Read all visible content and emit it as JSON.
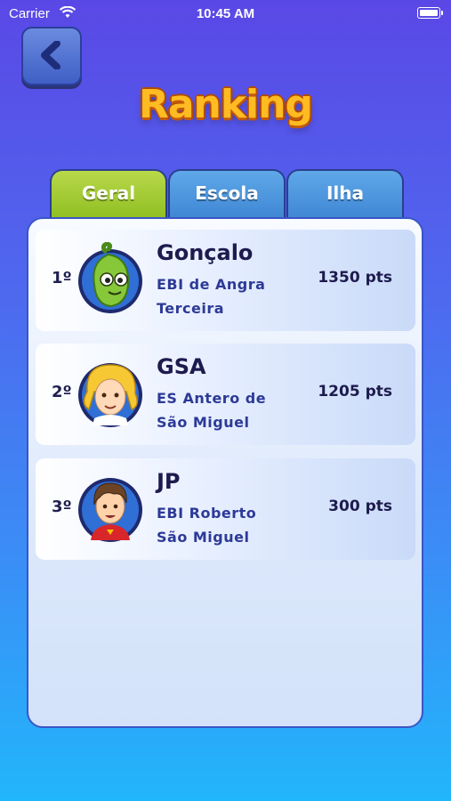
{
  "status_bar": {
    "carrier": "Carrier",
    "time": "10:45 AM"
  },
  "header": {
    "title": "Ranking",
    "back_icon": "chevron-left-icon"
  },
  "tabs": [
    {
      "label": "Geral",
      "active": true
    },
    {
      "label": "Escola",
      "active": false
    },
    {
      "label": "Ilha",
      "active": false
    }
  ],
  "ranking": [
    {
      "rank": "1º",
      "name": "Gonçalo",
      "school_line1": "EBI de Angra",
      "school_line2": "Terceira",
      "points": "1350 pts",
      "avatar": "green-alien-avatar"
    },
    {
      "rank": "2º",
      "name": "GSA",
      "school_line1": "ES Antero de",
      "school_line2": "São Miguel",
      "points": "1205 pts",
      "avatar": "blonde-girl-avatar"
    },
    {
      "rank": "3º",
      "name": "JP",
      "school_line1": "EBI Roberto",
      "school_line2": "São Miguel",
      "points": "300 pts",
      "avatar": "brown-hair-boy-avatar"
    }
  ],
  "colors": {
    "active_tab": "#9cc62e",
    "inactive_tab": "#4b95dc",
    "title": "#ffbb22",
    "text_dark": "#1d1b4e",
    "school_text": "#2d3a97"
  }
}
